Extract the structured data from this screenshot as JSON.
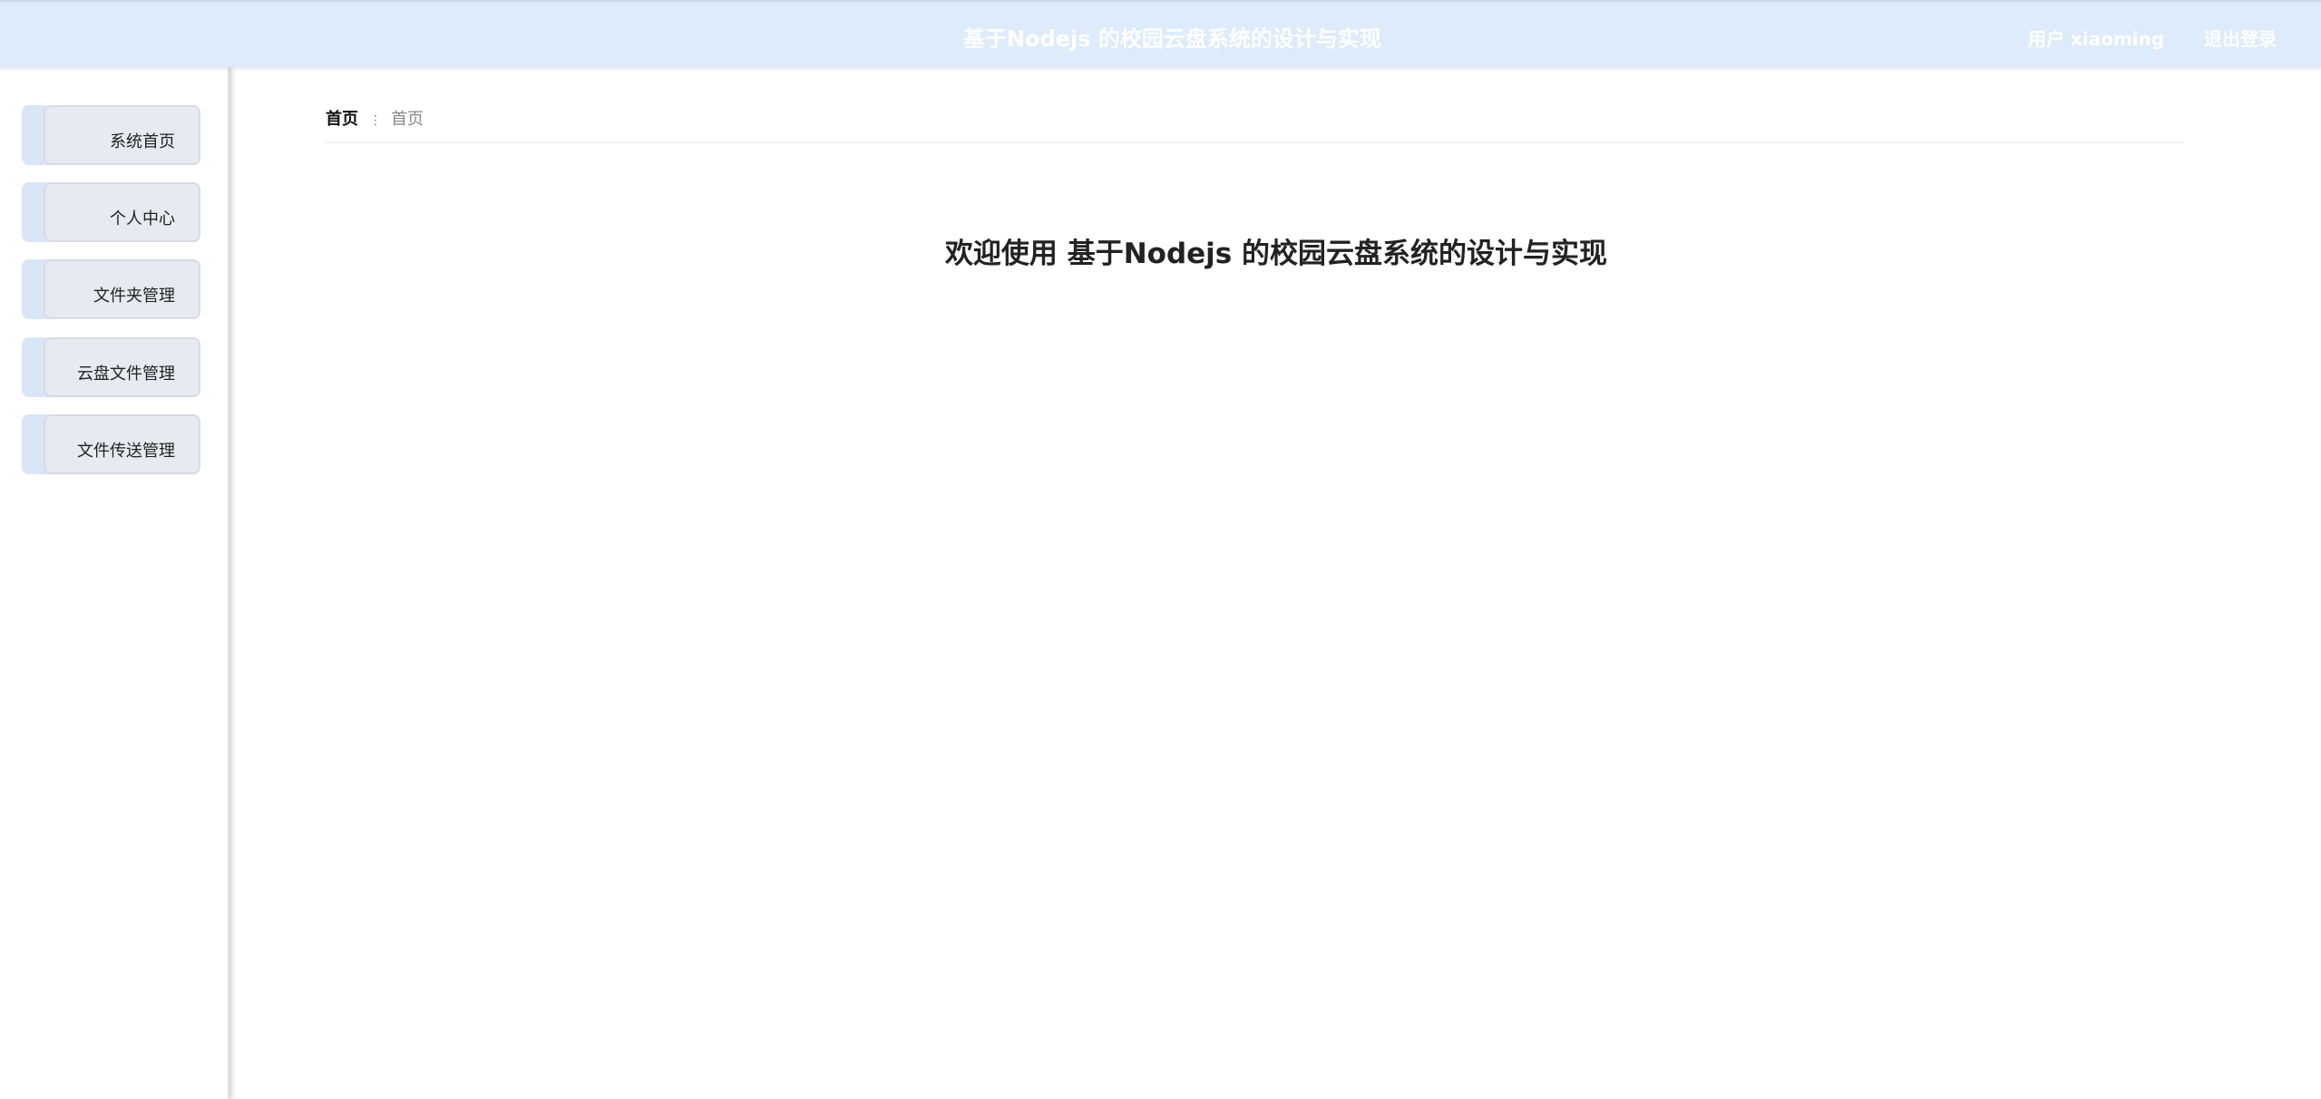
{
  "header": {
    "title": "基于Nodejs 的校园云盘系统的设计与实现",
    "user_label": "用户 xiaoming",
    "logout_label": "退出登录"
  },
  "sidebar": {
    "items": [
      {
        "label": "系统首页"
      },
      {
        "label": "个人中心"
      },
      {
        "label": "文件夹管理"
      },
      {
        "label": "云盘文件管理"
      },
      {
        "label": "文件传送管理"
      }
    ]
  },
  "breadcrumb": {
    "home": "首页",
    "separator": "⋮",
    "current": "首页"
  },
  "main": {
    "welcome": "欢迎使用 基于Nodejs 的校园云盘系统的设计与实现"
  },
  "colors": {
    "header_bg": "#deebfa",
    "nav_accent": "#d9e6f8",
    "nav_bg": "#e6eaf1"
  }
}
